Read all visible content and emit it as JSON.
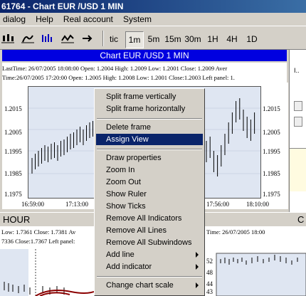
{
  "window": {
    "title": "61764 - Chart EUR /USD  1 MIN"
  },
  "menu": [
    "dialog",
    "Help",
    "Real account",
    "System"
  ],
  "toolbar": {
    "timeframes": [
      "tic",
      "1m",
      "5m",
      "15m",
      "30m",
      "1H",
      "4H",
      "1D"
    ],
    "active": "1m"
  },
  "chart": {
    "title": "Chart EUR /USD  1 MIN",
    "info1": "LastTime: 26/07/2005 18:08:00  Open: 1.2004  High: 1.2009  Low: 1.2001  Close: 1.2009  Aver",
    "info2": "Time:26/07/2005 17:20:00 Open: 1.2005 High: 1.2008 Low: 1.2001 Close:1.2003  Left panel: 1.",
    "y_ticks": [
      "1.2015",
      "1.2005",
      "1.1995",
      "1.1985",
      "1.1975"
    ],
    "x_ticks": [
      "16:59:00",
      "17:13:00",
      "17:56:00",
      "18:10:00"
    ]
  },
  "lower": {
    "left_title": "HOUR",
    "right_title": "C",
    "left_info1": "Low: 1.7361  Close: 1.7381  Av",
    "left_info2": "7336 Close:1.7367  Left panel: ",
    "right_info": "Time: 26/07/2005 18:00",
    "right_ticks": [
      "52",
      "48",
      "44",
      "43"
    ]
  },
  "right_panel": {
    "label": "I.."
  },
  "context_menu": {
    "items": [
      {
        "label": "Split frame vertically"
      },
      {
        "label": "Split frame horizontally"
      },
      {
        "label": "Delete frame"
      },
      {
        "label": "Assign View",
        "highlighted": true
      },
      {
        "label": "Draw properties"
      },
      {
        "label": "Zoom In"
      },
      {
        "label": "Zoom Out"
      },
      {
        "label": "Show Ruler"
      },
      {
        "label": "Show Ticks"
      },
      {
        "label": "Remove All Indicators"
      },
      {
        "label": "Remove All Lines"
      },
      {
        "label": "Remove All Subwindows"
      },
      {
        "label": "Add line",
        "submenu": true
      },
      {
        "label": "Add indicator",
        "submenu": true
      },
      {
        "label": "Change chart scale",
        "submenu": true
      }
    ]
  },
  "colors": {
    "title_bar": "#0a246a",
    "chart_title": "#0000e0",
    "plot_bg": "#dfe6f2",
    "highlight": "#0a246a"
  }
}
